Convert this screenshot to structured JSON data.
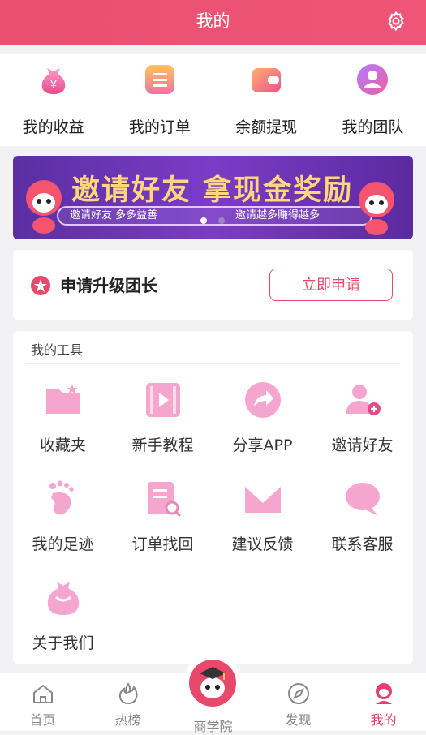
{
  "header": {
    "title": "我的"
  },
  "quick": [
    {
      "label": "我的收益",
      "icon": "money-bag-icon"
    },
    {
      "label": "我的订单",
      "icon": "order-list-icon"
    },
    {
      "label": "余额提现",
      "icon": "wallet-icon"
    },
    {
      "label": "我的团队",
      "icon": "team-icon"
    }
  ],
  "banner": {
    "title": "邀请好友  拿现金奖励",
    "sub_left": "邀请好友   多多益善",
    "sub_right": "邀请越多赚得越多"
  },
  "apply": {
    "text": "申请升级团长",
    "button": "立即申请"
  },
  "tools": {
    "title": "我的工具",
    "items": [
      {
        "label": "收藏夹",
        "icon": "folder-icon"
      },
      {
        "label": "新手教程",
        "icon": "video-tutorial-icon"
      },
      {
        "label": "分享APP",
        "icon": "share-icon"
      },
      {
        "label": "邀请好友",
        "icon": "invite-user-icon"
      },
      {
        "label": "我的足迹",
        "icon": "footprint-icon"
      },
      {
        "label": "订单找回",
        "icon": "order-search-icon"
      },
      {
        "label": "建议反馈",
        "icon": "feedback-icon"
      },
      {
        "label": "联系客服",
        "icon": "chat-icon"
      },
      {
        "label": "关于我们",
        "icon": "about-bag-icon"
      }
    ]
  },
  "tabbar": [
    {
      "label": "首页",
      "icon": "home-icon"
    },
    {
      "label": "热榜",
      "icon": "flame-icon"
    },
    {
      "label": "商学院",
      "icon": "graduation-mascot-icon"
    },
    {
      "label": "发现",
      "icon": "compass-icon"
    },
    {
      "label": "我的",
      "icon": "profile-icon",
      "active": true
    }
  ],
  "colors": {
    "accent": "#e8496b",
    "icon_pink": "#f4a6cf",
    "banner_purple": "#6a35b8"
  }
}
